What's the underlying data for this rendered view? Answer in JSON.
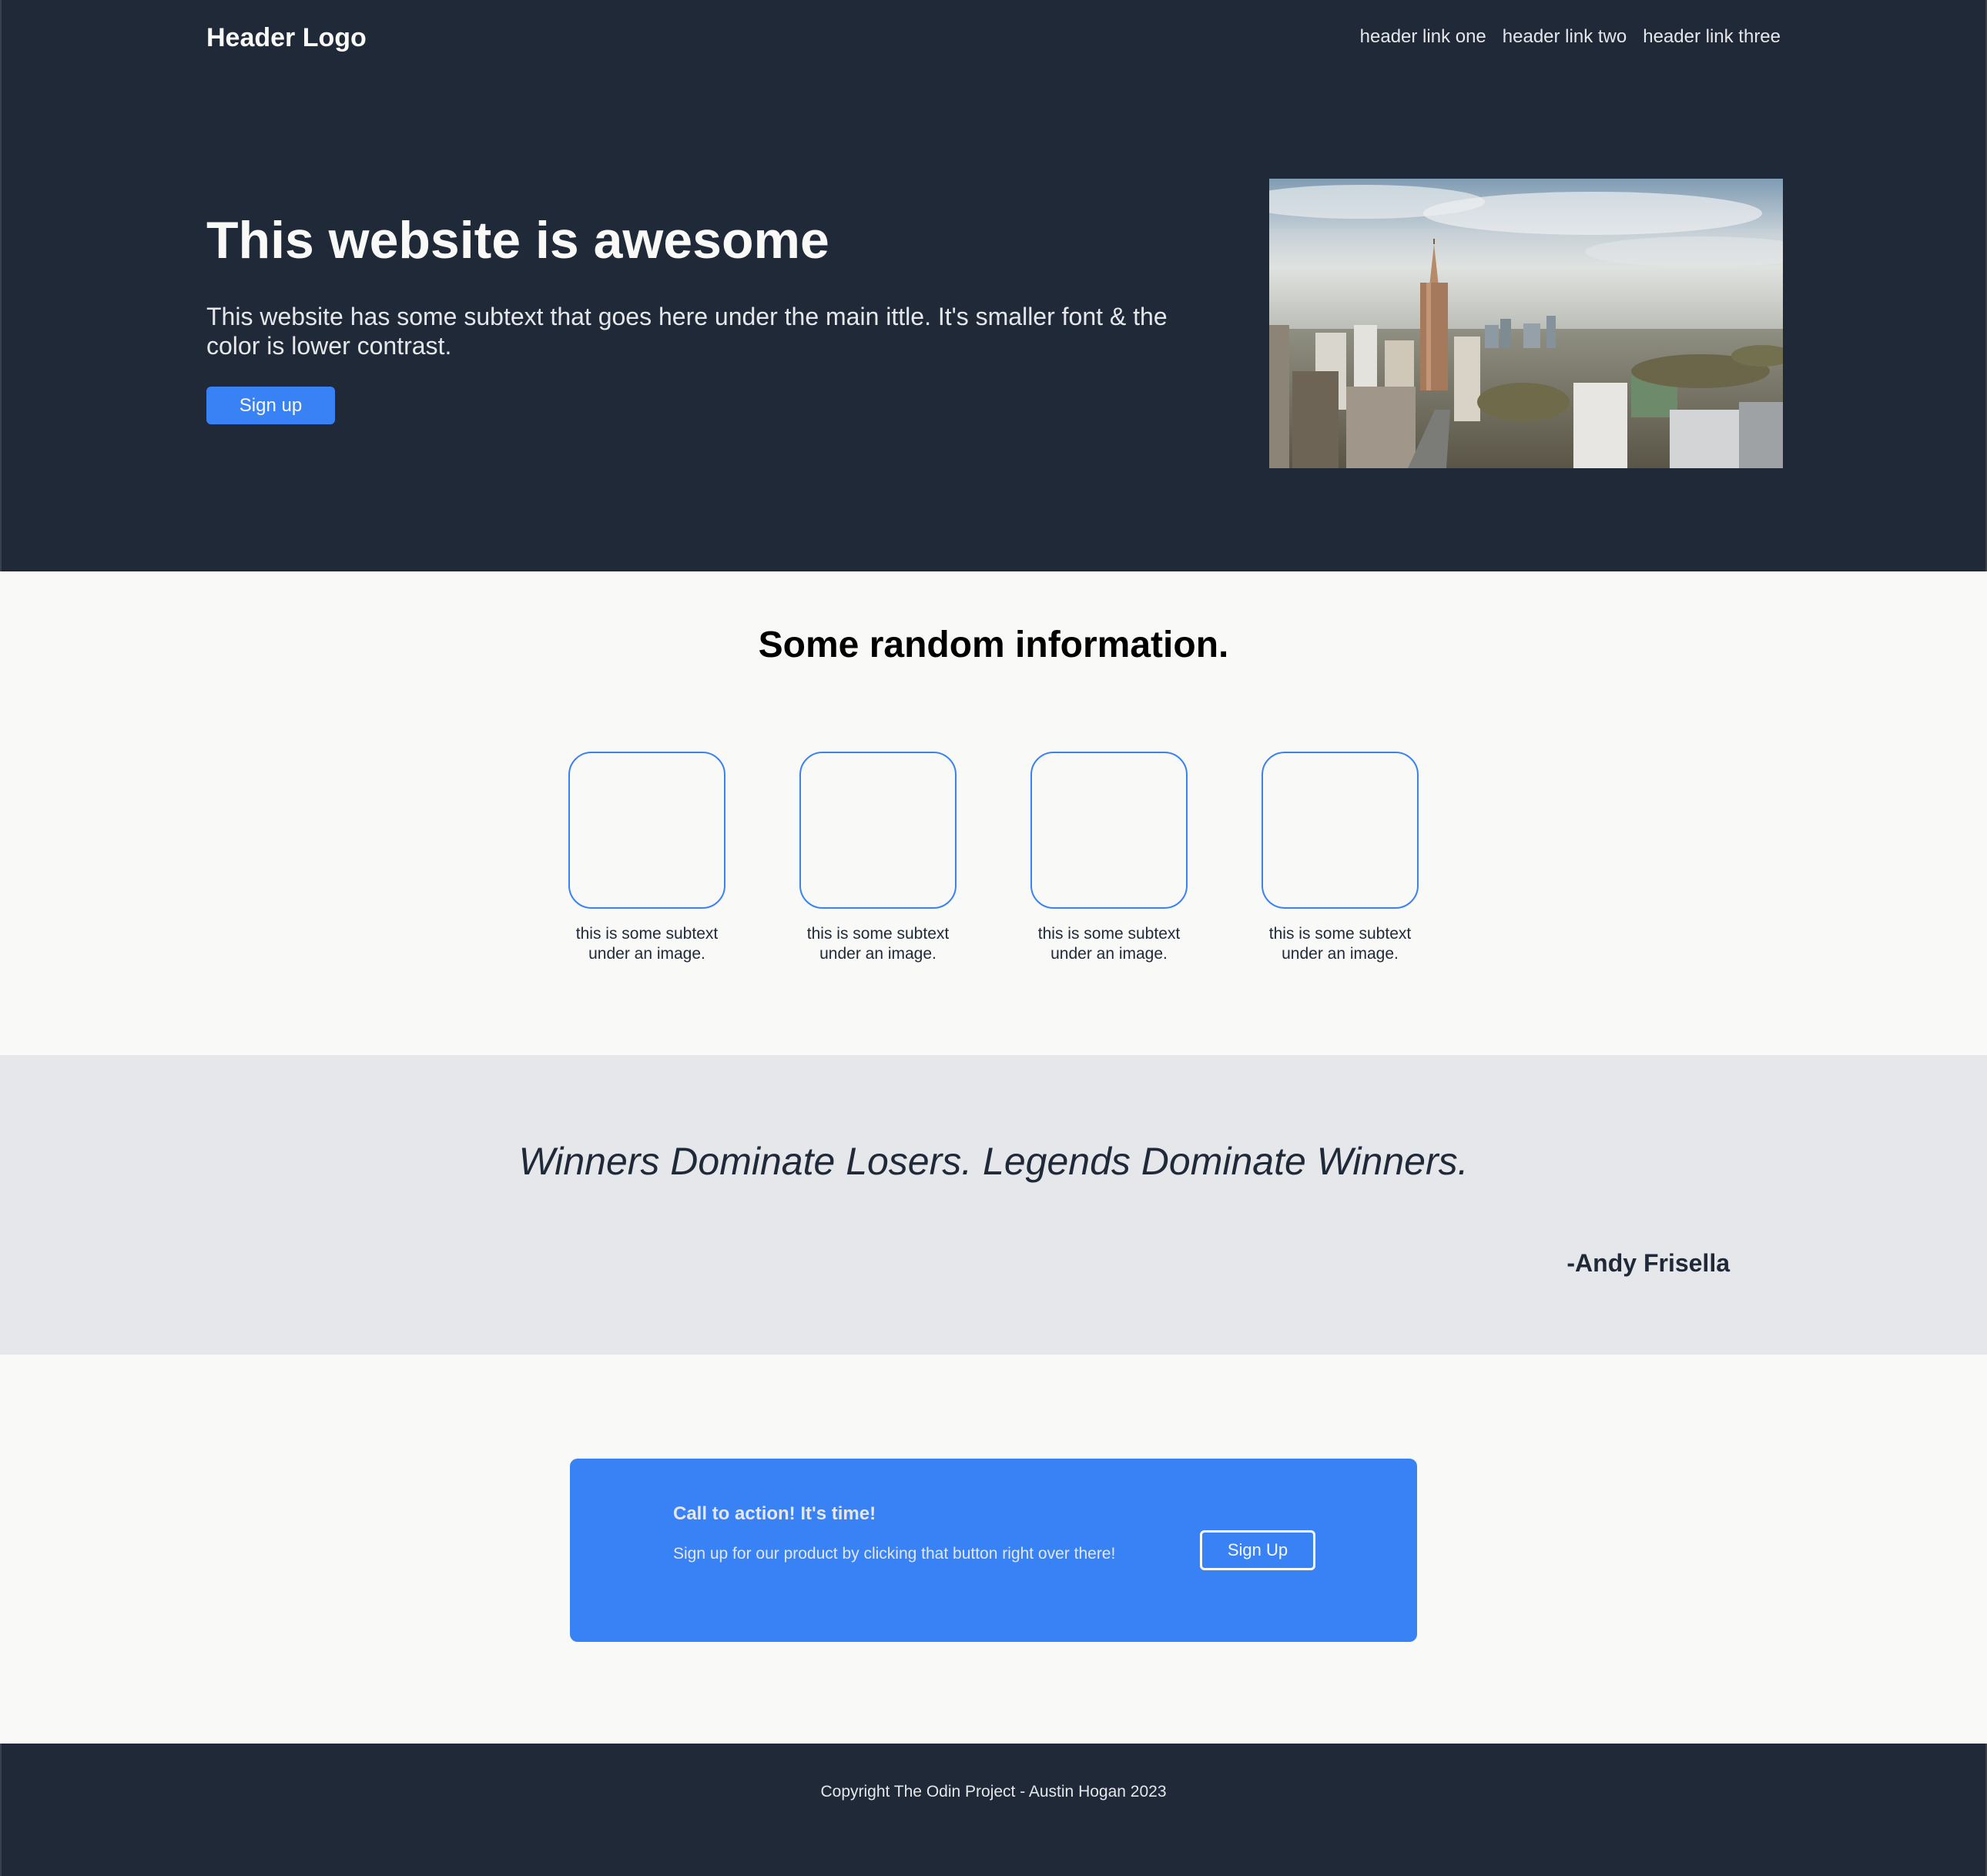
{
  "header": {
    "logo": "Header Logo",
    "links": [
      "header link one",
      "header link two",
      "header link three"
    ]
  },
  "hero": {
    "title": "This website is awesome",
    "subtext": "This website has some subtext that goes here under the main ittle. It's smaller font & the color is lower contrast.",
    "button_label": "Sign up",
    "image": "city-skyline-photo"
  },
  "info": {
    "title": "Some random information.",
    "cards": [
      {
        "text": "this is some subtext under an image."
      },
      {
        "text": "this is some subtext under an image."
      },
      {
        "text": "this is some subtext under an image."
      },
      {
        "text": "this is some subtext under an image."
      }
    ]
  },
  "quote": {
    "text": "Winners Dominate Losers. Legends Dominate Winners.",
    "author": "-Andy Frisella"
  },
  "cta": {
    "heading": "Call to action! It's time!",
    "text": "Sign up for our product by clicking that button right over there!",
    "button_label": "Sign Up"
  },
  "footer": {
    "text": "Copyright The Odin Project - Austin Hogan 2023"
  },
  "colors": {
    "dark": "#1f2937",
    "accent": "#3882f6",
    "light": "#f9faf8",
    "muted": "#e5e7eb"
  }
}
